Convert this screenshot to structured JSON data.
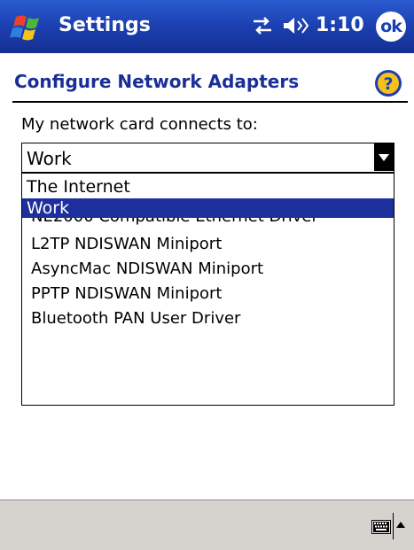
{
  "titlebar": {
    "title": "Settings",
    "clock": "1:10",
    "ok_label": "ok"
  },
  "page": {
    "heading": "Configure Network Adapters",
    "prompt": "My network card connects to:"
  },
  "dropdown": {
    "selected": "Work",
    "options": [
      "The Internet",
      "Work"
    ],
    "highlighted": "Work"
  },
  "adapters": [
    "NE2000 Compatible Ethernet Driver",
    "L2TP NDISWAN Miniport",
    "AsyncMac NDISWAN Miniport",
    "PPTP NDISWAN Miniport",
    "Bluetooth PAN User Driver"
  ],
  "colors": {
    "titlebar": "#1c3fb0",
    "heading": "#1a2e98",
    "selection": "#1c2f9c",
    "bottombar": "#d6d3ce"
  },
  "icons": {
    "start": "windows-flag-icon",
    "connectivity": "connectivity-icon",
    "volume": "volume-icon",
    "help": "help-icon",
    "keyboard": "keyboard-icon",
    "input_menu": "chevron-up-icon"
  }
}
